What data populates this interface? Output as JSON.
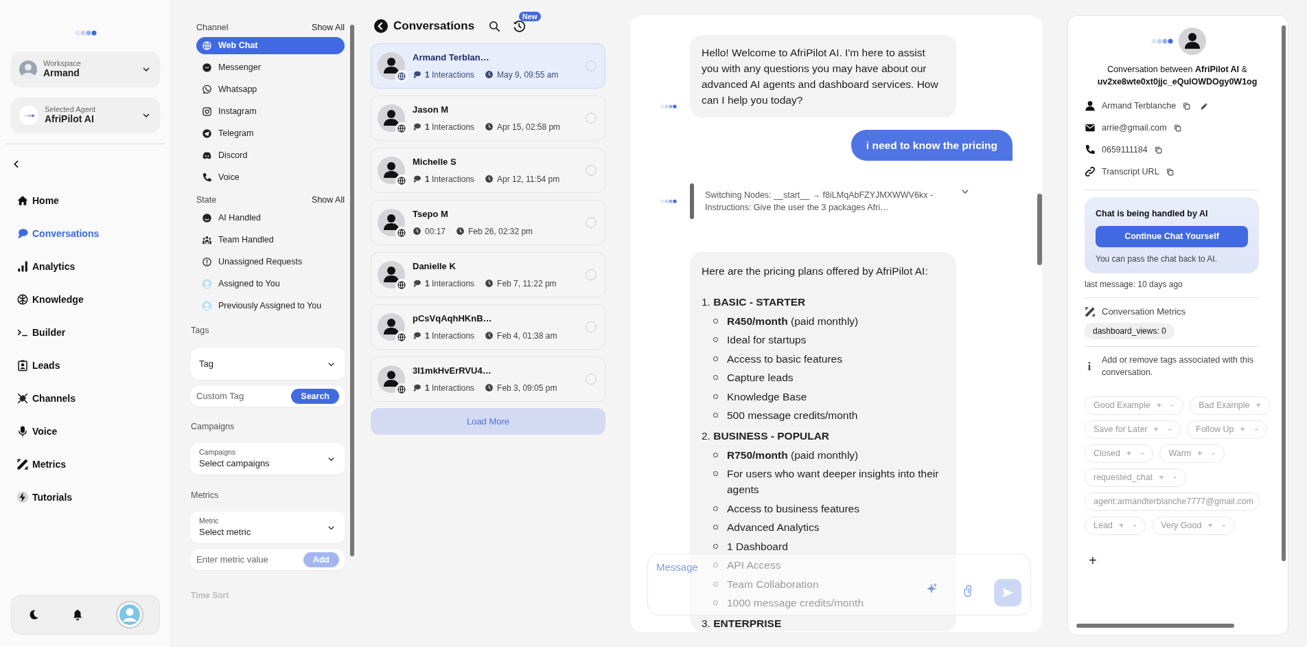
{
  "sidebar": {
    "workspace": {
      "label": "Workspace",
      "value": "Armand"
    },
    "agent": {
      "label": "Selected Agent",
      "value": "AfriPilot AI"
    },
    "nav": [
      {
        "label": "Home",
        "selected": false
      },
      {
        "label": "Conversations",
        "selected": true
      },
      {
        "label": "Analytics",
        "selected": false
      },
      {
        "label": "Knowledge",
        "selected": false
      },
      {
        "label": "Builder",
        "selected": false
      },
      {
        "label": "Leads",
        "selected": false
      },
      {
        "label": "Channels",
        "selected": false
      },
      {
        "label": "Voice",
        "selected": false
      },
      {
        "label": "Metrics",
        "selected": false
      },
      {
        "label": "Tutorials",
        "selected": false
      }
    ]
  },
  "filters": {
    "channel": {
      "title": "Channel",
      "show_all": "Show All",
      "items": [
        {
          "label": "Web Chat",
          "selected": true
        },
        {
          "label": "Messenger",
          "selected": false
        },
        {
          "label": "Whatsapp",
          "selected": false
        },
        {
          "label": "Instagram",
          "selected": false
        },
        {
          "label": "Telegram",
          "selected": false
        },
        {
          "label": "Discord",
          "selected": false
        },
        {
          "label": "Voice",
          "selected": false
        }
      ]
    },
    "state": {
      "title": "State",
      "show_all": "Show All",
      "items": [
        {
          "label": "AI Handled",
          "selected": false
        },
        {
          "label": "Team Handled",
          "selected": false
        },
        {
          "label": "Unassigned Requests",
          "selected": false
        },
        {
          "label": "Assigned to You",
          "selected": false
        },
        {
          "label": "Previously Assigned to You",
          "selected": false
        }
      ]
    },
    "tags": {
      "title": "Tags",
      "select": "Tag",
      "custom_placeholder": "Custom Tag",
      "search_button": "Search"
    },
    "campaigns": {
      "title": "Campaigns",
      "select_label": "Campaigns",
      "select_value": "Select campaigns"
    },
    "metrics": {
      "title": "Metrics",
      "select_label": "Metric",
      "select_value": "Select metric",
      "value_placeholder": "Enter metric value",
      "add_button": "Add",
      "add_disabled": true
    },
    "time_sort": {
      "title": "Time Sort"
    }
  },
  "conversations": {
    "title": "Conversations",
    "new_badge": "New",
    "items": [
      {
        "name": "Armand Terblan…",
        "kind": "interactions",
        "stat": "**1** Interactions",
        "date": "May 9, 09:55 am",
        "selected": true,
        "checked": false
      },
      {
        "name": "Jason M",
        "kind": "interactions",
        "stat": "**1** Interactions",
        "date": "Apr 15, 02:58 pm",
        "selected": false,
        "checked": false
      },
      {
        "name": "Michelle S",
        "kind": "interactions",
        "stat": "**1** Interactions",
        "date": "Apr 12, 11:54 pm",
        "selected": false,
        "checked": false
      },
      {
        "name": "Tsepo M",
        "kind": "duration",
        "stat": "00:17",
        "date": "Feb 26, 02:32 pm",
        "selected": false,
        "checked": false
      },
      {
        "name": "Danielle K",
        "kind": "interactions",
        "stat": "**1** Interactions",
        "date": "Feb 7, 11:22 pm",
        "selected": false,
        "checked": false
      },
      {
        "name": "pCsVqAqhHKnB…",
        "kind": "interactions",
        "stat": "**1** Interactions",
        "date": "Feb 4, 01:38 am",
        "selected": false,
        "checked": false
      },
      {
        "name": "3I1mkHvErRVU4…",
        "kind": "interactions",
        "stat": "**1** Interactions",
        "date": "Feb 3, 09:05 pm",
        "selected": false,
        "checked": false
      }
    ],
    "load_more": "Load More"
  },
  "chat": {
    "messages": [
      {
        "kind": "bot",
        "text": "Hello! Welcome to AfriPilot AI. I'm here to assist you with any questions you may have about our advanced AI agents and dashboard services. How can I help you today?"
      },
      {
        "kind": "user",
        "text": "i need to know the pricing"
      },
      {
        "kind": "node",
        "text": "Switching Nodes: __start__ → f8iLMqAbFZYJMXWWV6kx - Instructions: Give the user the 3 packages Afri…",
        "expanded": false
      },
      {
        "kind": "plans",
        "intro": "Here are the pricing plans offered by AfriPilot AI:",
        "plans": [
          {
            "number": "1.",
            "title": "BASIC - STARTER",
            "items": [
              "**R450/month** (paid monthly)",
              "Ideal for startups",
              "Access to basic features",
              "Capture leads",
              "Knowledge Base",
              "500 message credits/month"
            ]
          },
          {
            "number": "2.",
            "title": "BUSINESS - POPULAR",
            "items": [
              "**R750/month** (paid monthly)",
              "For users who want deeper insights into their agents",
              "Access to business features",
              "Advanced Analytics",
              "1 Dashboard",
              "API Access",
              "Team Collaboration",
              "1000 message credits/month"
            ]
          },
          {
            "number": "3.",
            "title": "ENTERPRISE"
          }
        ]
      }
    ],
    "input": {
      "placeholder": "Message",
      "send_disabled": true
    }
  },
  "details": {
    "title": "Conversation between **AfriPilot AI** &",
    "conversation_id": "uv2xe8wte0xt0jjc_eQulOWDOgy0W1og",
    "contact": [
      {
        "kind": "name",
        "text": "Armand Terblanche",
        "editable": true
      },
      {
        "kind": "email",
        "text": "arrie@gmail.com",
        "editable": false
      },
      {
        "kind": "phone",
        "text": "0659111184",
        "editable": false
      },
      {
        "kind": "link",
        "text": "Transcript URL",
        "editable": false
      }
    ],
    "handler": {
      "title": "Chat is being handled by AI",
      "button": "Continue Chat Yourself",
      "note": "You can pass the chat back to AI."
    },
    "last_message": "last message: 10 days ago",
    "metrics_title": "Conversation Metrics",
    "metrics": [
      "dashboard_views: 0"
    ],
    "tags_info": "Add or remove tags associated with this conversation.",
    "tags": [
      {
        "label": "Good Example",
        "signs": [
          "+",
          "-"
        ]
      },
      {
        "label": "Bad Example",
        "signs": [
          "+"
        ]
      },
      {
        "label": "Save for Later",
        "signs": [
          "+",
          "-"
        ]
      },
      {
        "label": "Follow Up",
        "signs": [
          "+",
          "-"
        ]
      },
      {
        "label": "Closed",
        "signs": [
          "+",
          "-"
        ]
      },
      {
        "label": "Warm",
        "signs": [
          "+",
          "-"
        ]
      },
      {
        "label": "requested_chat",
        "signs": [
          "+",
          "-"
        ]
      },
      {
        "label": "agent:armandterblanche7777@gmail.com"
      },
      {
        "label": "Lead",
        "signs": [
          "+",
          "-"
        ]
      },
      {
        "label": "Very Good",
        "signs": [
          "+",
          "-"
        ]
      }
    ],
    "add_tag": "+"
  }
}
